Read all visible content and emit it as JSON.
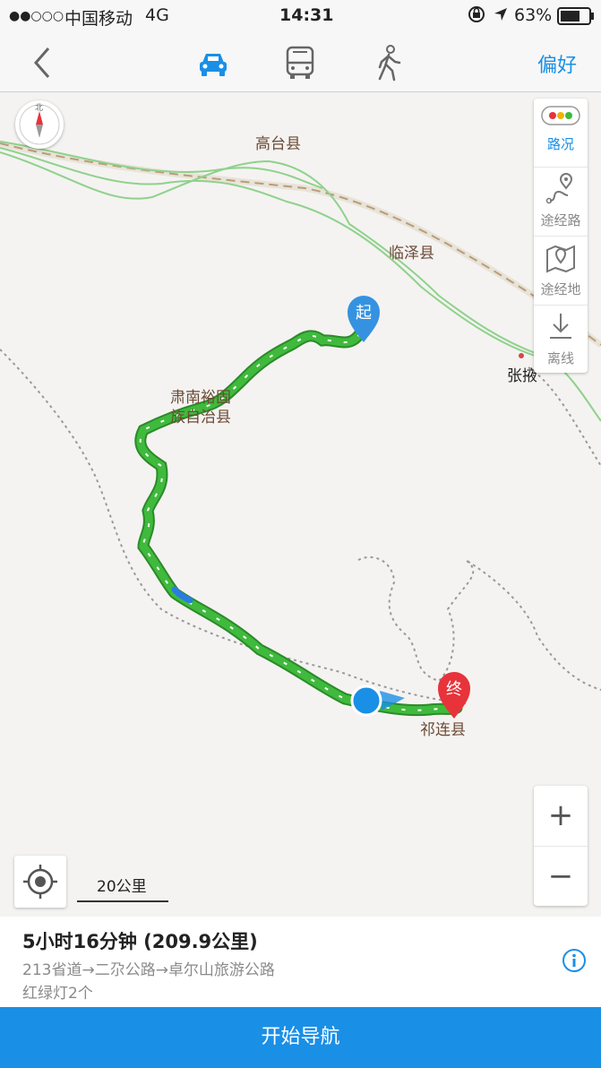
{
  "status_bar": {
    "signal": "●●○○○",
    "carrier": "中国移动",
    "network": "4G",
    "time": "14:31",
    "battery": "63%"
  },
  "nav": {
    "back_icon": "chevron-left-icon",
    "modes": [
      "car-icon",
      "bus-icon",
      "walk-icon"
    ],
    "active_mode": "car-icon",
    "preference_label": "偏好"
  },
  "map": {
    "compass_label": "北",
    "places": {
      "gaotai": "高台县",
      "linze": "临泽县",
      "zhangye": "张掖",
      "sunan": "肃南裕固族自治县",
      "sunan_line1": "肃南裕固",
      "sunan_line2": "族自治县",
      "qilian": "祁连县"
    },
    "start_marker": "起",
    "end_marker": "终",
    "scale_label": "20公里"
  },
  "tools": {
    "traffic": "路况",
    "waypoint_road": "途经路",
    "waypoint_place": "途经地",
    "offline": "离线"
  },
  "zoom": {
    "in": "+",
    "out": "−"
  },
  "route": {
    "summary": "5小时16分钟 (209.9公里)",
    "roads": "213省道→二尕公路→卓尔山旅游公路",
    "traffic_lights": "红绿灯2个"
  },
  "start_nav_label": "开始导航",
  "colors": {
    "accent": "#1a8fe6",
    "route": "#3fba3c",
    "end_marker": "#e8333b"
  }
}
